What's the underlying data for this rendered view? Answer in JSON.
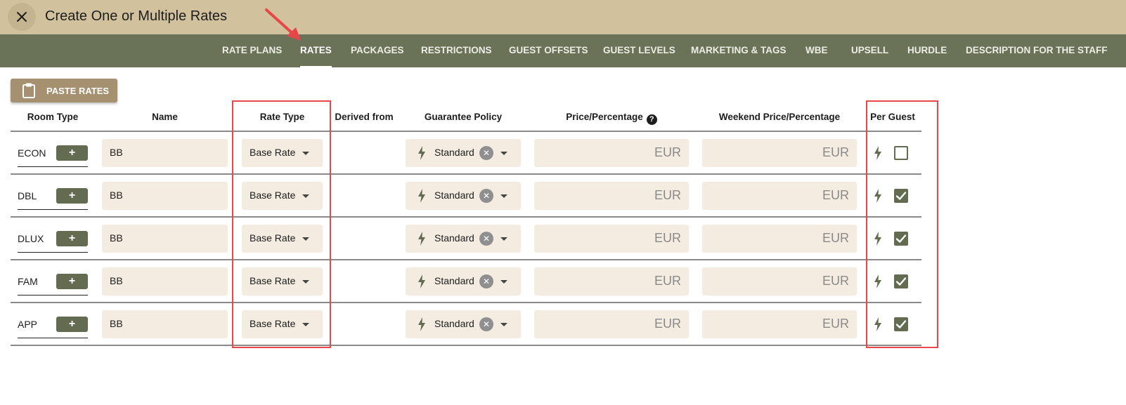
{
  "window": {
    "title": "Create One or Multiple Rates",
    "close_icon": "close-icon"
  },
  "tabs": [
    {
      "label": "RATE PLANS",
      "active": false
    },
    {
      "label": "RATES",
      "active": true
    },
    {
      "label": "PACKAGES",
      "active": false
    },
    {
      "label": "RESTRICTIONS",
      "active": false
    },
    {
      "label": "GUEST OFFSETS",
      "active": false
    },
    {
      "label": "GUEST LEVELS",
      "active": false
    },
    {
      "label": "MARKETING & TAGS",
      "active": false
    },
    {
      "label": "WBE",
      "active": false
    },
    {
      "label": "UPSELL",
      "active": false
    },
    {
      "label": "HURDLE",
      "active": false
    },
    {
      "label": "DESCRIPTION FOR THE STAFF",
      "active": false
    }
  ],
  "toolbar": {
    "paste_label": "PASTE RATES",
    "paste_icon": "clipboard-icon"
  },
  "table": {
    "headers": {
      "room_type": "Room Type",
      "name": "Name",
      "rate_type": "Rate Type",
      "derived_from": "Derived from",
      "guarantee_policy": "Guarantee Policy",
      "price": "Price/Percentage",
      "price_help": "?",
      "weekend_price": "Weekend Price/Percentage",
      "per_guest": "Per Guest"
    },
    "rows": [
      {
        "room": "ECON",
        "add": "+",
        "name": "BB",
        "rate_type": "Base Rate",
        "derived_from": "",
        "guarantee": "Standard",
        "clear": "✕",
        "price_currency": "EUR",
        "weekend_currency": "EUR",
        "per_guest": false
      },
      {
        "room": "DBL",
        "add": "+",
        "name": "BB",
        "rate_type": "Base Rate",
        "derived_from": "",
        "guarantee": "Standard",
        "clear": "✕",
        "price_currency": "EUR",
        "weekend_currency": "EUR",
        "per_guest": true
      },
      {
        "room": "DLUX",
        "add": "+",
        "name": "BB",
        "rate_type": "Base Rate",
        "derived_from": "",
        "guarantee": "Standard",
        "clear": "✕",
        "price_currency": "EUR",
        "weekend_currency": "EUR",
        "per_guest": true
      },
      {
        "room": "FAM",
        "add": "+",
        "name": "BB",
        "rate_type": "Base Rate",
        "derived_from": "",
        "guarantee": "Standard",
        "clear": "✕",
        "price_currency": "EUR",
        "weekend_currency": "EUR",
        "per_guest": true
      },
      {
        "room": "APP",
        "add": "+",
        "name": "BB",
        "rate_type": "Base Rate",
        "derived_from": "",
        "guarantee": "Standard",
        "clear": "✕",
        "price_currency": "EUR",
        "weekend_currency": "EUR",
        "per_guest": true
      }
    ]
  },
  "colors": {
    "topbar": "#d2c19d",
    "tabsbar": "#6a7258",
    "accent": "#636b50",
    "field_bg": "#f4ebe1",
    "annotation": "#e8474a"
  }
}
